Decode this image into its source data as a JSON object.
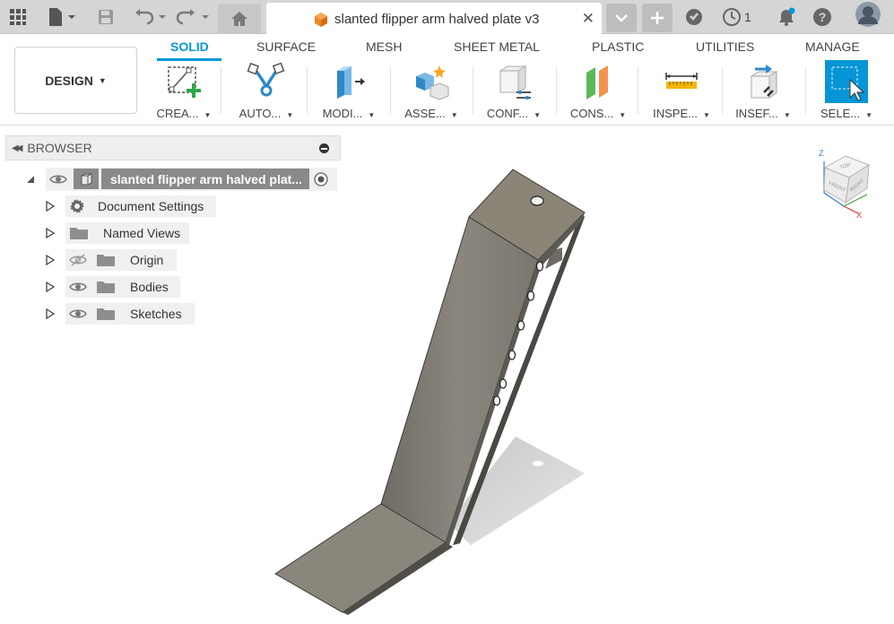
{
  "app": {
    "notifications_count": "1",
    "document_title": "slanted flipper arm halved plate v3"
  },
  "ribbon": {
    "workspace_label": "DESIGN",
    "tabs": [
      "SOLID",
      "SURFACE",
      "MESH",
      "SHEET METAL",
      "PLASTIC",
      "UTILITIES",
      "MANAGE"
    ],
    "active_tab": "SOLID",
    "tools": [
      {
        "label": "CREA...",
        "icon": "create-sketch-icon"
      },
      {
        "label": "AUTO...",
        "icon": "automate-icon"
      },
      {
        "label": "MODI...",
        "icon": "modify-icon"
      },
      {
        "label": "ASSE...",
        "icon": "assemble-icon"
      },
      {
        "label": "CONF...",
        "icon": "configure-icon"
      },
      {
        "label": "CONS...",
        "icon": "construct-icon"
      },
      {
        "label": "INSPE...",
        "icon": "inspect-icon"
      },
      {
        "label": "INSEF...",
        "icon": "insert-icon"
      },
      {
        "label": "SELE...",
        "icon": "select-icon"
      }
    ]
  },
  "browser": {
    "title": "BROWSER",
    "root_label": "slanted flipper arm halved plat...",
    "items": [
      {
        "label": "Document Settings",
        "icon": "gear-icon"
      },
      {
        "label": "Named Views",
        "icon": "folder-icon"
      },
      {
        "label": "Origin",
        "icon": "folder-icon",
        "visibility": "hidden"
      },
      {
        "label": "Bodies",
        "icon": "folder-icon",
        "visibility": "visible"
      },
      {
        "label": "Sketches",
        "icon": "folder-icon",
        "visibility": "visible"
      }
    ]
  },
  "viewcube": {
    "top": "TOP",
    "front": "FRONT",
    "right": "RIGHT",
    "z": "Z",
    "x": "X"
  },
  "colors": {
    "accent": "#0696d7",
    "part_face": "#7e7a72",
    "part_top": "#8a8577",
    "shadow": "#cfcfcf"
  }
}
